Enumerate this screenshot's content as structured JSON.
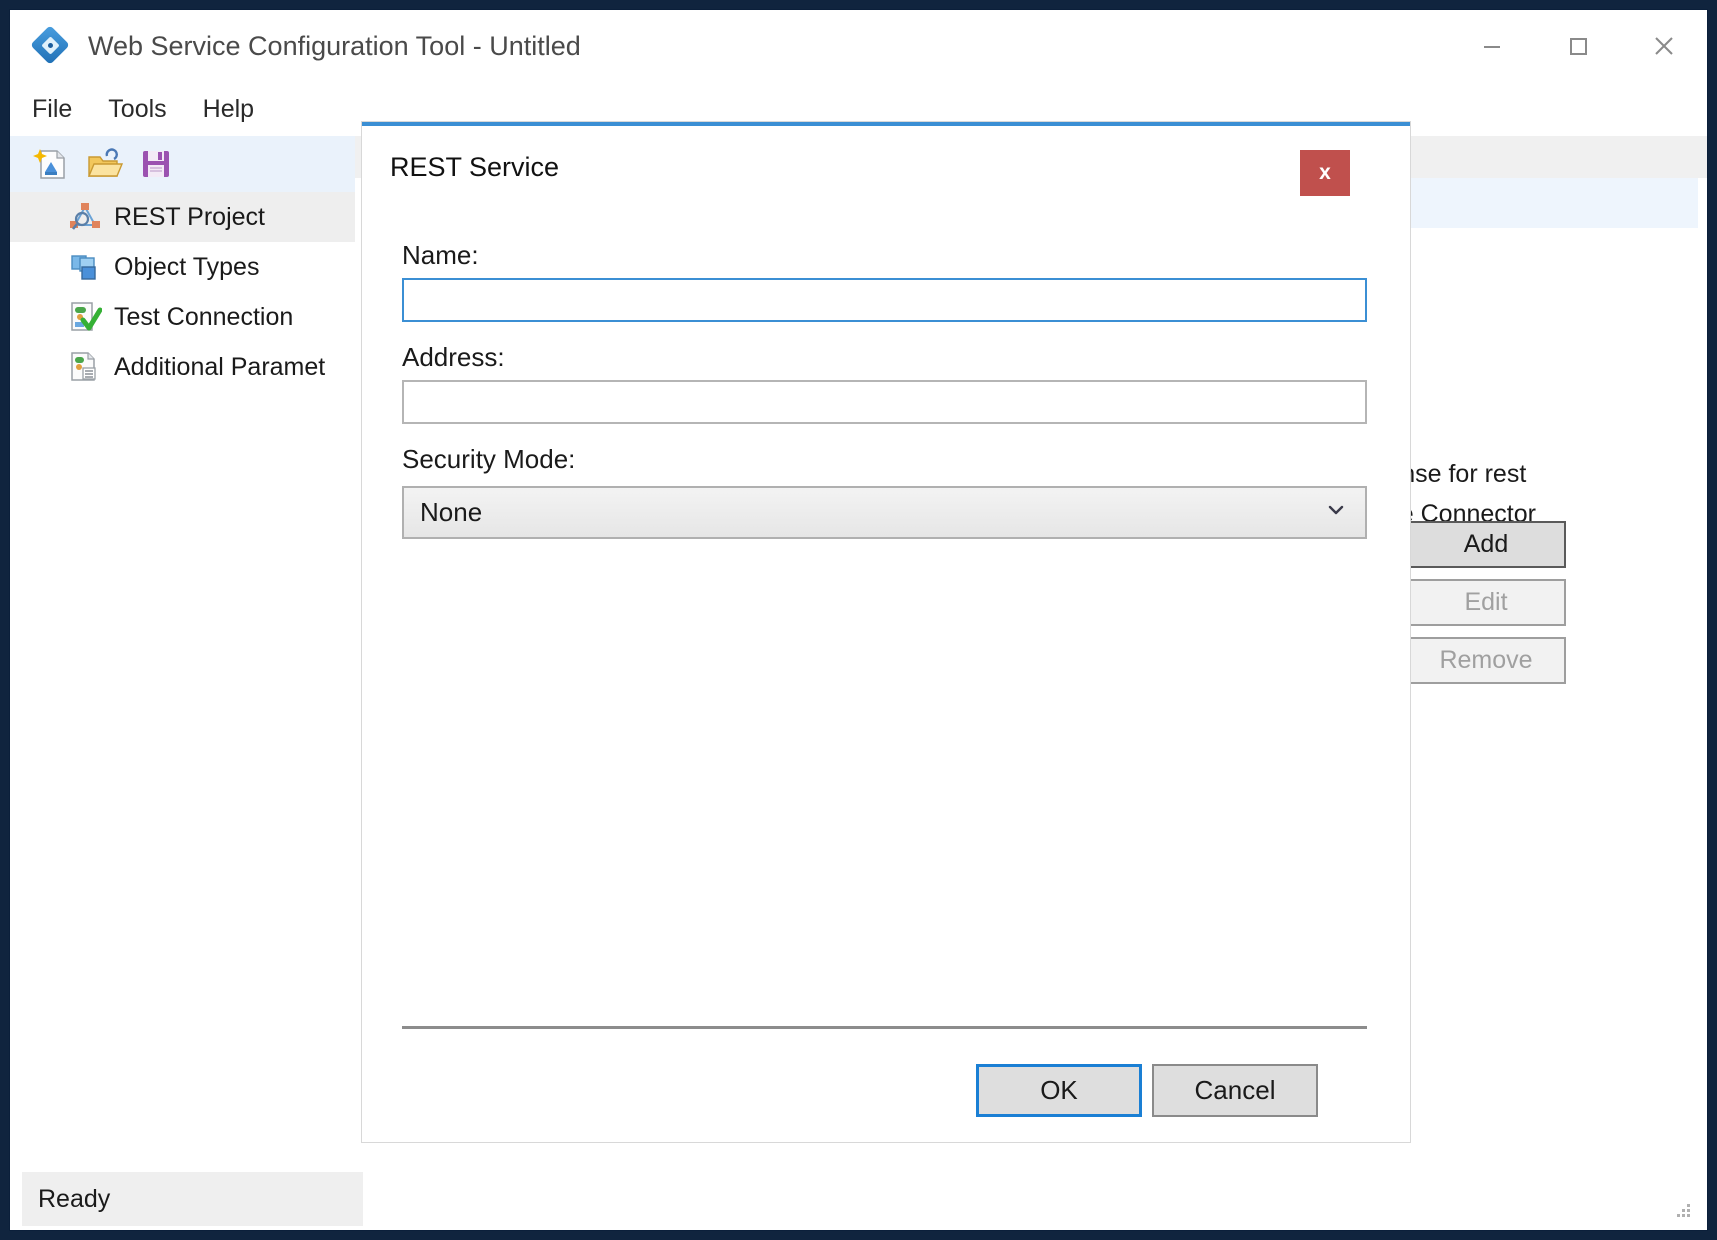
{
  "window": {
    "title": "Web Service Configuration Tool - Untitled",
    "icon": "app-diamond-icon",
    "controls": {
      "minimize": "minimize-icon",
      "maximize": "maximize-icon",
      "close": "close-icon"
    }
  },
  "menu": {
    "items": [
      {
        "label": "File"
      },
      {
        "label": "Tools"
      },
      {
        "label": "Help"
      }
    ]
  },
  "toolbar": {
    "buttons": [
      {
        "name": "new-project-icon",
        "tooltip": "New"
      },
      {
        "name": "open-project-icon",
        "tooltip": "Open"
      },
      {
        "name": "save-project-icon",
        "tooltip": "Save"
      }
    ]
  },
  "tree": {
    "items": [
      {
        "label": "REST Project",
        "icon": "rest-project-icon",
        "selected": true
      },
      {
        "label": "Object Types",
        "icon": "object-types-icon",
        "selected": false
      },
      {
        "label": "Test Connection",
        "icon": "test-connection-icon",
        "selected": false
      },
      {
        "label": "Additional Paramet",
        "icon": "additional-parameters-icon",
        "selected": false
      }
    ]
  },
  "background": {
    "description_line1": "esponse for rest",
    "description_line2": "ervice Connector",
    "buttons": [
      {
        "label": "Add",
        "enabled": true
      },
      {
        "label": "Edit",
        "enabled": false
      },
      {
        "label": "Remove",
        "enabled": false
      }
    ]
  },
  "dialog": {
    "title": "REST Service",
    "close_label": "x",
    "fields": {
      "name_label": "Name:",
      "name_value": "",
      "name_placeholder": "",
      "address_label": "Address:",
      "address_value": "",
      "address_placeholder": "",
      "security_label": "Security Mode:",
      "security_value": "None",
      "security_options": [
        "None"
      ],
      "chevron": "chevron-down-icon"
    },
    "ok_label": "OK",
    "cancel_label": "Cancel"
  },
  "status": {
    "text": "Ready"
  },
  "colors": {
    "accent": "#3b8fd4",
    "close_button": "#c0504d",
    "selection": "#eeeeee",
    "toolbar_bg": "#eaf2fb"
  }
}
